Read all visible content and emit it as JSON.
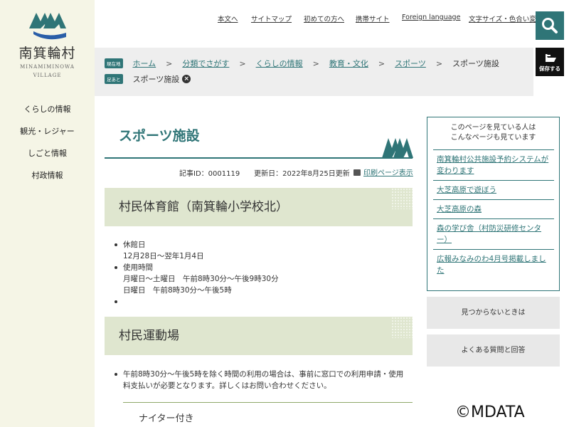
{
  "site": {
    "name": "南箕輪村",
    "name_en_line1": "MINAMIMINOWA",
    "name_en_line2": "VILLAGE"
  },
  "sidebar": {
    "items": [
      {
        "label": "くらしの情報"
      },
      {
        "label": "観光・レジャー"
      },
      {
        "label": "しごと情報"
      },
      {
        "label": "村政情報"
      }
    ]
  },
  "header": {
    "links": [
      {
        "label": "本文へ"
      },
      {
        "label": "サイトマップ"
      },
      {
        "label": "初めての方へ"
      },
      {
        "label": "携帯サイト"
      },
      {
        "label": "Foreign language"
      },
      {
        "label": "文字サイズ・色合い変更"
      }
    ],
    "search_icon": "search-icon",
    "save_label": "保存する"
  },
  "breadcrumb": {
    "badge_current": "現在地",
    "items": [
      {
        "label": "ホーム"
      },
      {
        "label": "分類でさがす"
      },
      {
        "label": "くらしの情報"
      },
      {
        "label": "教育・文化"
      },
      {
        "label": "スポーツ"
      }
    ],
    "current": "スポーツ施設",
    "badge_history": "足あと",
    "history_item": "スポーツ施設"
  },
  "main": {
    "title": "スポーツ施設",
    "meta": "記事ID：0001119　　更新日：2022年8月25日更新",
    "print_label": "印刷ページ表示",
    "sections": [
      {
        "heading": "村民体育館（南箕輪小学校北）",
        "items": [
          {
            "label": "休館日",
            "lines": [
              "12月28日～翌年1月4日"
            ]
          },
          {
            "label": "使用時間",
            "lines": [
              "月曜日～土曜日　午前8時30分～午後9時30分",
              "日曜日　午前8時30分～午後5時"
            ]
          },
          {
            "label": "",
            "lines": []
          }
        ]
      },
      {
        "heading": "村民運動場",
        "items": [
          {
            "label": "午前8時30分～午後5時を除く時間の利用の場合は、事前に窓口での利用申請・使用",
            "lines": [
              "料支払いが必要となります。詳しくはお問い合わせください。"
            ]
          }
        ],
        "subheading": "ナイター付き"
      }
    ]
  },
  "related": {
    "heading_line1": "このページを見ている人は",
    "heading_line2": "こんなページも見ています",
    "items": [
      {
        "label": "南箕輪村公共施設予約システムが変わります"
      },
      {
        "label": "大芝高原で遊ぼう"
      },
      {
        "label": "大芝高原の森"
      },
      {
        "label": "森の学び舎（村防災研修センター）"
      },
      {
        "label": "広報みなみのわ4月号掲載しました"
      }
    ]
  },
  "buttons": {
    "not_found": "見つからないときは",
    "faq": "よくある質問と回答"
  },
  "watermark": "©MDATA",
  "colors": {
    "accent": "#2f7577",
    "section_bg": "#dfe6cf",
    "sidebar_bg": "#f5f5e6"
  }
}
